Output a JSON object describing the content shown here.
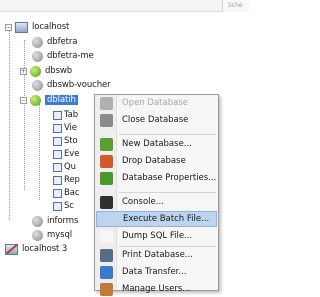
{
  "header": {
    "tab_label": "Sche"
  },
  "tree": {
    "connection_label": "localhost",
    "databases": [
      {
        "label": "dbfetra"
      },
      {
        "label": "dbfetra-me"
      },
      {
        "label": "dbswb"
      },
      {
        "label": "dbswb-voucher"
      },
      {
        "label": "dblatih"
      }
    ],
    "tables": [
      {
        "label": "Tab"
      },
      {
        "label": "Vie"
      },
      {
        "label": "Sto"
      },
      {
        "label": "Eve"
      },
      {
        "label": "Qu"
      },
      {
        "label": "Rep"
      },
      {
        "label": "Bac"
      },
      {
        "label": "Sc"
      }
    ],
    "other_databases": [
      {
        "label": "informs"
      },
      {
        "label": "mysql"
      }
    ],
    "second_connection_label": "localhost 3"
  },
  "context_menu": {
    "items": [
      {
        "label": "Open Database",
        "icon": "database-open-icon",
        "color": "#b0b0b0",
        "disabled": true
      },
      {
        "label": "Close Database",
        "icon": "database-close-icon",
        "color": "#8a8a8a",
        "disabled": false
      },
      {
        "label": "New Database...",
        "icon": "database-new-icon",
        "color": "#5aa02c",
        "disabled": false
      },
      {
        "label": "Drop Database",
        "icon": "database-drop-icon",
        "color": "#d05a2a",
        "disabled": false
      },
      {
        "label": "Database Properties...",
        "icon": "database-properties-icon",
        "color": "#4a9a2a",
        "disabled": false
      },
      {
        "label": "Console...",
        "icon": "console-icon",
        "color": "#303030",
        "disabled": false
      },
      {
        "label": "Execute Batch File...",
        "icon": "execute-batch-icon",
        "color": "#bcd4ee",
        "disabled": false,
        "hover": true
      },
      {
        "label": "Dump SQL File...",
        "icon": "dump-sql-icon",
        "color": "#f6f6f6",
        "disabled": false
      },
      {
        "label": "Print Database...",
        "icon": "print-icon",
        "color": "#5a6a8a",
        "disabled": false
      },
      {
        "label": "Data Transfer...",
        "icon": "data-transfer-icon",
        "color": "#3a7acc",
        "disabled": false
      },
      {
        "label": "Manage Users...",
        "icon": "manage-users-icon",
        "color": "#c07a3a",
        "disabled": false
      }
    ]
  }
}
